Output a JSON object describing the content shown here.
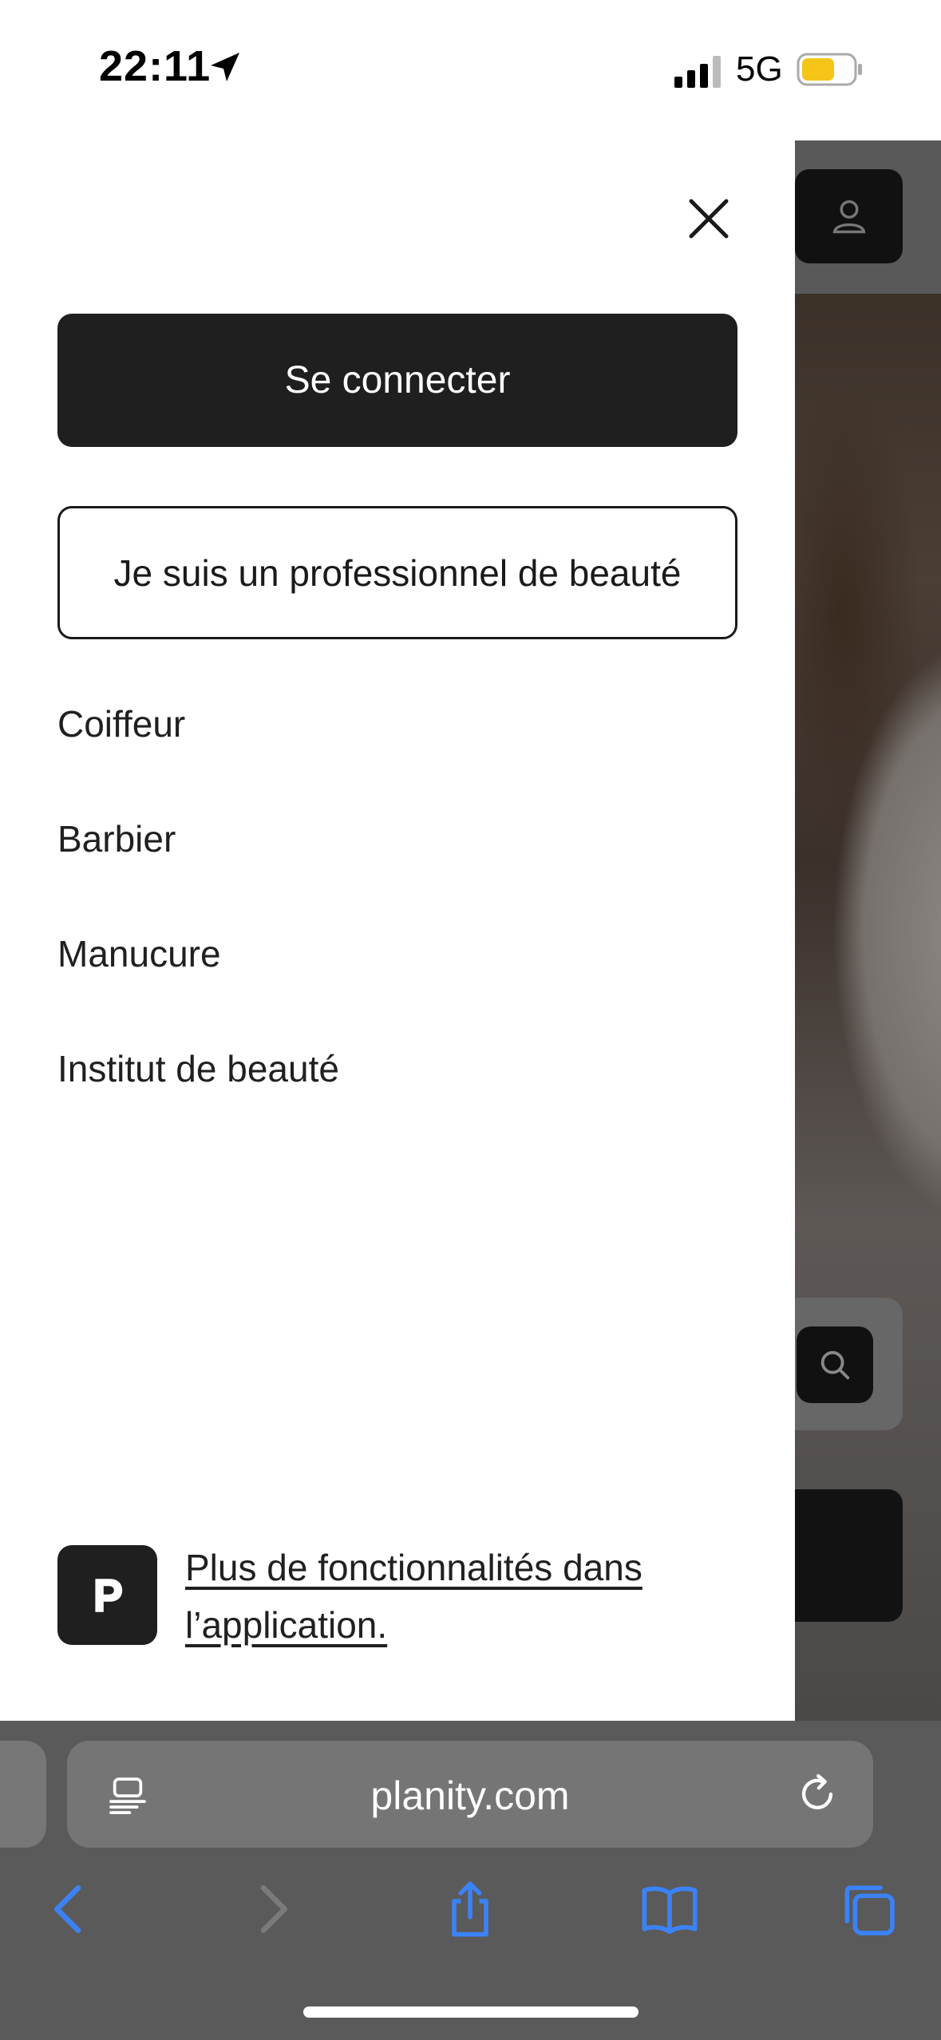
{
  "status_bar": {
    "time": "22:11",
    "network": "5G"
  },
  "drawer": {
    "login_label": "Se connecter",
    "pro_label": "Je suis un professionnel de beauté",
    "menu": [
      {
        "label": "Coiffeur"
      },
      {
        "label": "Barbier"
      },
      {
        "label": "Manucure"
      },
      {
        "label": "Institut de beauté"
      }
    ],
    "app_promo_label": "Plus de fonctionnalités dans l’application."
  },
  "browser": {
    "url": "planity.com"
  },
  "colors": {
    "primary_button": "#1f1f1f",
    "safari_accent": "#3b82f6",
    "battery": "#f5c518"
  }
}
